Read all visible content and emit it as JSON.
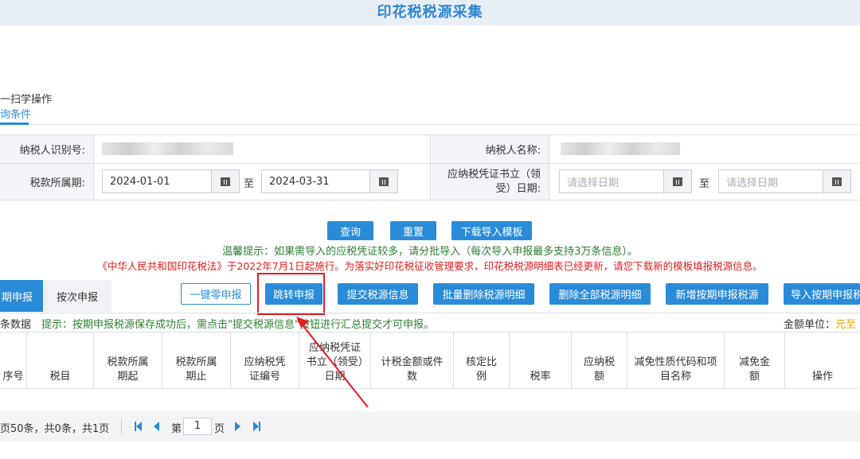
{
  "page": {
    "title": "印花税税源采集"
  },
  "nav": {
    "breadcrumb_top": "一扫学操作",
    "breadcrumb_bottom": "询条件"
  },
  "form": {
    "taxpayer_id_label": "纳税人识别号:",
    "taxpayer_name_label": "纳税人名称:",
    "period_label": "税款所属期:",
    "period_start": "2024-01-01",
    "period_end": "2024-03-31",
    "to_label": "至",
    "doc_date_label": "应纳税凭证书立（领受）日期:",
    "doc_date_start_placeholder": "请选择日期",
    "doc_date_end_placeholder": "请选择日期"
  },
  "search_buttons": {
    "query": "查询",
    "reset": "重置",
    "download_template": "下载导入模板"
  },
  "tips": {
    "green": "温馨提示：如果需导入的应税凭证较多，请分批导入（每次导入申报最多支持3万条信息）。",
    "red": "《中华人民共和国印花税法》于2022年7月1日起施行。为落实好印花税征收管理要求，印花税税源明细表已经更新，请您下载新的模板填报税源信息。"
  },
  "tabs": {
    "periodic": "期申报",
    "per_time": "按次申报"
  },
  "actions": {
    "zero_declare": "一键零申报",
    "jump_declare": "跳转申报",
    "submit_source": "提交税源信息",
    "batch_delete": "批量删除税源明细",
    "delete_all": "删除全部税源明细",
    "add_periodic": "新增按期申报税源",
    "import_periodic": "导入按期申报税"
  },
  "infobar": {
    "count_text": "条数据",
    "tip": "提示：按期申报税源保存成功后，需点击\"提交税源信息\"按钮进行汇总提交才可申报。",
    "unit_label": "金额单位：",
    "unit_value": "元至"
  },
  "table": {
    "headers": {
      "seq": "序号",
      "tax_item": "税目",
      "period_start": "税款所属期起",
      "period_end": "税款所属期止",
      "doc_no": "应纳税凭证编号",
      "doc_date": "应纳税凭证书立（领受）日期",
      "tax_basis": "计税金额或件数",
      "ratio": "核定比例",
      "tax_rate": "税率",
      "tax_payable": "应纳税额",
      "relief_code": "减免性质代码和项目名称",
      "relief_amount": "减免金额",
      "operation": "操作"
    }
  },
  "pagination": {
    "summary": "页50条，共0条，共1页",
    "page_prefix": "第",
    "page_value": "1",
    "page_suffix": "页"
  },
  "colors": {
    "accent": "#2a8bd8",
    "tip_green": "#2e7d32",
    "tip_red": "#e02020",
    "highlight_box": "#e51c23"
  }
}
